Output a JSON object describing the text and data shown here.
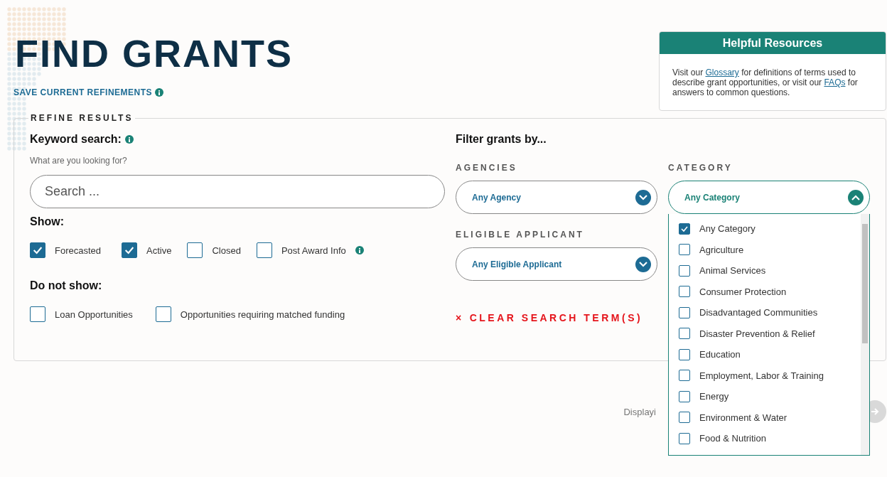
{
  "page": {
    "title": "FIND GRANTS",
    "save_link": "SAVE CURRENT REFINEMENTS"
  },
  "resources": {
    "title": "Helpful Resources",
    "parts": [
      {
        "kind": "text",
        "text": "Visit our "
      },
      {
        "kind": "link",
        "text": "Glossary"
      },
      {
        "kind": "text",
        "text": " for definitions of terms used to describe grant opportunities, or visit our "
      },
      {
        "kind": "link",
        "text": "FAQs"
      },
      {
        "kind": "text",
        "text": " for answers to common questions."
      }
    ]
  },
  "refine": {
    "legend": "REFINE RESULTS",
    "keyword_label": "Keyword search:",
    "hint": "What are you looking for?",
    "search": {
      "placeholder": "Search ..."
    },
    "show_label": "Show:",
    "show": [
      {
        "label": "Forecasted",
        "checked": true,
        "info": false
      },
      {
        "label": "Active",
        "checked": true,
        "info": false
      },
      {
        "label": "Closed",
        "checked": false,
        "info": false
      },
      {
        "label": "Post Award Info",
        "checked": false,
        "info": true
      }
    ],
    "hide_label": "Do not show:",
    "hide": [
      {
        "label": "Loan Opportunities",
        "checked": false
      },
      {
        "label": "Opportunities requiring matched funding",
        "checked": false
      }
    ],
    "filter_label": "Filter grants by...",
    "agencies": {
      "label": "AGENCIES",
      "value": "Any Agency",
      "expanded": false
    },
    "eligible": {
      "label": "ELIGIBLE APPLICANT",
      "value": "Any Eligible Applicant",
      "expanded": false
    },
    "clear": {
      "icon": "×",
      "label": "CLEAR SEARCH TERM(S)"
    },
    "category": {
      "label": "CATEGORY",
      "value": "Any Category",
      "expanded": true,
      "options": [
        {
          "label": "Any Category",
          "checked": true
        },
        {
          "label": "Agriculture",
          "checked": false
        },
        {
          "label": "Animal Services",
          "checked": false
        },
        {
          "label": "Consumer Protection",
          "checked": false
        },
        {
          "label": "Disadvantaged Communities",
          "checked": false
        },
        {
          "label": "Disaster Prevention & Relief",
          "checked": false
        },
        {
          "label": "Education",
          "checked": false
        },
        {
          "label": "Employment, Labor & Training",
          "checked": false
        },
        {
          "label": "Energy",
          "checked": false
        },
        {
          "label": "Environment & Water",
          "checked": false
        },
        {
          "label": "Food & Nutrition",
          "checked": false
        }
      ]
    }
  },
  "results": {
    "displaying": "Displayi"
  }
}
